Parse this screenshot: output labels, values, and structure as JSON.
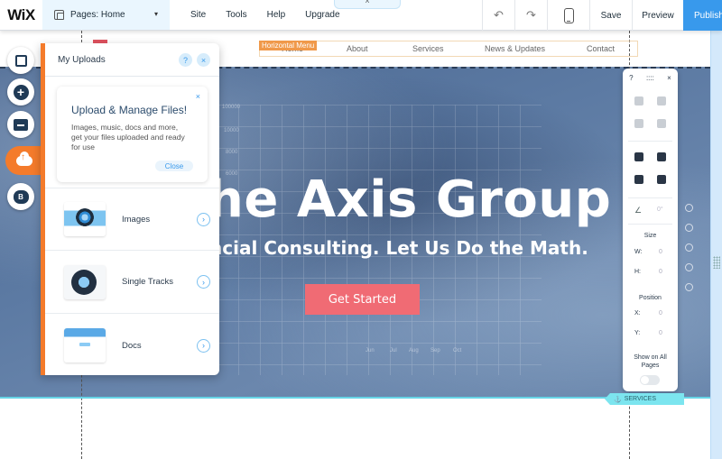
{
  "topbar": {
    "logo": "WiX",
    "pages_label": "Pages: Home",
    "menu": [
      "Site",
      "Tools",
      "Help",
      "Upgrade"
    ],
    "collapse_glyph": "^",
    "save_label": "Save",
    "preview_label": "Preview",
    "publish_label": "Publish",
    "undo_glyph": "↶",
    "redo_glyph": "↷",
    "chevron": "▾"
  },
  "site_menu": {
    "badge": "Horizontal Menu",
    "items": [
      "Home",
      "About",
      "Services",
      "News & Updates",
      "Contact"
    ]
  },
  "hero": {
    "title": "he Axis Group",
    "subtitle": "ncial Consulting.  Let Us Do the Math.",
    "cta_label": "Get Started",
    "bg_axis_y": [
      "100000",
      "10000",
      "8000",
      "6000"
    ],
    "bg_axis_x": [
      "Jun",
      "Jul",
      "Aug",
      "Sep",
      "Oct"
    ]
  },
  "uploads_panel": {
    "title": "My Uploads",
    "help_glyph": "?",
    "close_glyph": "×",
    "welcome": {
      "heading": "Upload & Manage Files!",
      "body": "Images, music, docs and more, get your files uploaded and ready for use",
      "close_label": "Close",
      "dismiss_glyph": "×"
    },
    "items": [
      {
        "label": "Images",
        "icon": "camera-icon"
      },
      {
        "label": "Single Tracks",
        "icon": "vinyl-record-icon"
      },
      {
        "label": "Docs",
        "icon": "folder-icon"
      }
    ],
    "arrow_glyph": "›"
  },
  "left_rail": {
    "items": [
      "pages-menu",
      "add",
      "app-market",
      "my-uploads",
      "blog"
    ],
    "active": "my-uploads",
    "blog_glyph": "B",
    "add_glyph": "+"
  },
  "properties_panel": {
    "help_glyph": "?",
    "close_glyph": "×",
    "size_label": "Size",
    "w_label": "W:",
    "w_value": "0",
    "h_label": "H:",
    "h_value": "0",
    "position_label": "Position",
    "x_label": "X:",
    "x_value": "0",
    "y_label": "Y:",
    "y_value": "0",
    "rotation_value": "0°",
    "show_all_label": "Show on All Pages",
    "show_all_on": false
  },
  "anchor": {
    "label": "SERVICES"
  }
}
